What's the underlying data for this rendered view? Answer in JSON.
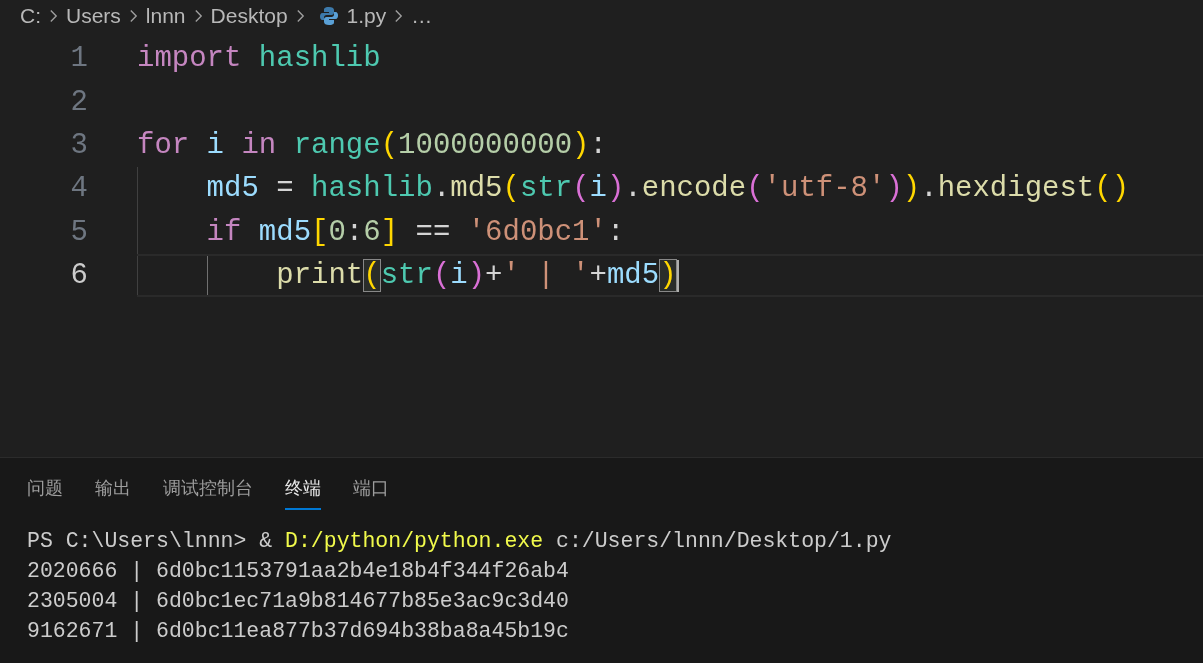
{
  "breadcrumb": [
    {
      "text": "C:",
      "kind": "folder"
    },
    {
      "text": "Users",
      "kind": "folder"
    },
    {
      "text": "lnnn",
      "kind": "folder"
    },
    {
      "text": "Desktop",
      "kind": "folder"
    },
    {
      "text": "1.py",
      "kind": "file"
    },
    {
      "text": "…",
      "kind": "more"
    }
  ],
  "editor": {
    "lines": [
      {
        "number": "1",
        "current": false,
        "tokens": [
          {
            "text": "import",
            "kind": "keyword"
          },
          {
            "text": " hashlib",
            "kind": "module"
          }
        ]
      },
      {
        "number": "2",
        "current": false
      },
      {
        "number": "3",
        "current": false,
        "tokens": [
          {
            "text": "for",
            "kind": "keyword"
          },
          {
            "text": " i",
            "kind": "var"
          },
          {
            "text": " in",
            "kind": "keyword"
          },
          {
            "text": " range",
            "kind": "module"
          },
          {
            "text": "(",
            "kind": "bracket1"
          },
          {
            "text": "1000000000",
            "kind": "number"
          },
          {
            "text": ")",
            "kind": "bracket1"
          },
          {
            "text": ":",
            "kind": "plain"
          }
        ]
      },
      {
        "number": "4",
        "current": false,
        "tokens": [
          {
            "text": "    md5",
            "kind": "var"
          },
          {
            "text": " = ",
            "kind": "plain"
          },
          {
            "text": "hashlib",
            "kind": "module"
          },
          {
            "text": ".",
            "kind": "plain"
          },
          {
            "text": "md5",
            "kind": "func"
          },
          {
            "text": "(",
            "kind": "bracket1"
          },
          {
            "text": "str",
            "kind": "module"
          },
          {
            "text": "(",
            "kind": "bracket2"
          },
          {
            "text": "i",
            "kind": "var"
          },
          {
            "text": ")",
            "kind": "bracket2"
          },
          {
            "text": ".",
            "kind": "plain"
          },
          {
            "text": "encode",
            "kind": "func"
          },
          {
            "text": "(",
            "kind": "bracket2"
          },
          {
            "text": "'utf-8'",
            "kind": "string"
          },
          {
            "text": ")",
            "kind": "bracket2"
          },
          {
            "text": ")",
            "kind": "bracket1"
          },
          {
            "text": ".",
            "kind": "plain"
          },
          {
            "text": "hexdigest",
            "kind": "func"
          },
          {
            "text": "(",
            "kind": "bracket1"
          },
          {
            "text": ")",
            "kind": "bracket1"
          }
        ]
      },
      {
        "number": "5",
        "current": false,
        "tokens": [
          {
            "text": "    if",
            "kind": "keyword"
          },
          {
            "text": " md5",
            "kind": "var"
          },
          {
            "text": "[",
            "kind": "bracket1"
          },
          {
            "text": "0",
            "kind": "number"
          },
          {
            "text": ":",
            "kind": "plain"
          },
          {
            "text": "6",
            "kind": "number"
          },
          {
            "text": "]",
            "kind": "bracket1"
          },
          {
            "text": " == ",
            "kind": "plain"
          },
          {
            "text": "'6d0bc1'",
            "kind": "string"
          },
          {
            "text": ":",
            "kind": "plain"
          }
        ]
      },
      {
        "number": "6",
        "current": true,
        "tokens": [
          {
            "text": "        print",
            "kind": "func",
            "matched": false
          },
          {
            "text": "(",
            "kind": "bracket1",
            "matched": true
          },
          {
            "text": "str",
            "kind": "module",
            "matched": false
          },
          {
            "text": "(",
            "kind": "bracket2",
            "matched": false
          },
          {
            "text": "i",
            "kind": "var",
            "matched": false
          },
          {
            "text": ")",
            "kind": "bracket2",
            "matched": false
          },
          {
            "text": "+",
            "kind": "plain",
            "matched": false
          },
          {
            "text": "' | '",
            "kind": "string",
            "matched": false
          },
          {
            "text": "+",
            "kind": "plain",
            "matched": false
          },
          {
            "text": "md5",
            "kind": "var",
            "matched": false
          },
          {
            "text": ")",
            "kind": "bracket1",
            "matched": true
          }
        ]
      }
    ]
  },
  "panel": {
    "tabs": [
      {
        "label": "问题",
        "selected": false
      },
      {
        "label": "输出",
        "selected": false
      },
      {
        "label": "调试控制台",
        "selected": false
      },
      {
        "label": "终端",
        "selected": true
      },
      {
        "label": "端口",
        "selected": false
      }
    ],
    "terminal": {
      "command": [
        {
          "text": "PS C:\\Users\\lnnn> & ",
          "kind": "plain"
        },
        {
          "text": "D:/python/python.exe",
          "kind": "exe"
        },
        {
          "text": " c:/Users/lnnn/Desktop/1.py",
          "kind": "plain"
        }
      ],
      "output": [
        "2020666 | 6d0bc1153791aa2b4e18b4f344f26ab4",
        "2305004 | 6d0bc1ec71a9b814677b85e3ac9c3d40",
        "9162671 | 6d0bc11ea877b37d694b38ba8a45b19c"
      ]
    }
  }
}
